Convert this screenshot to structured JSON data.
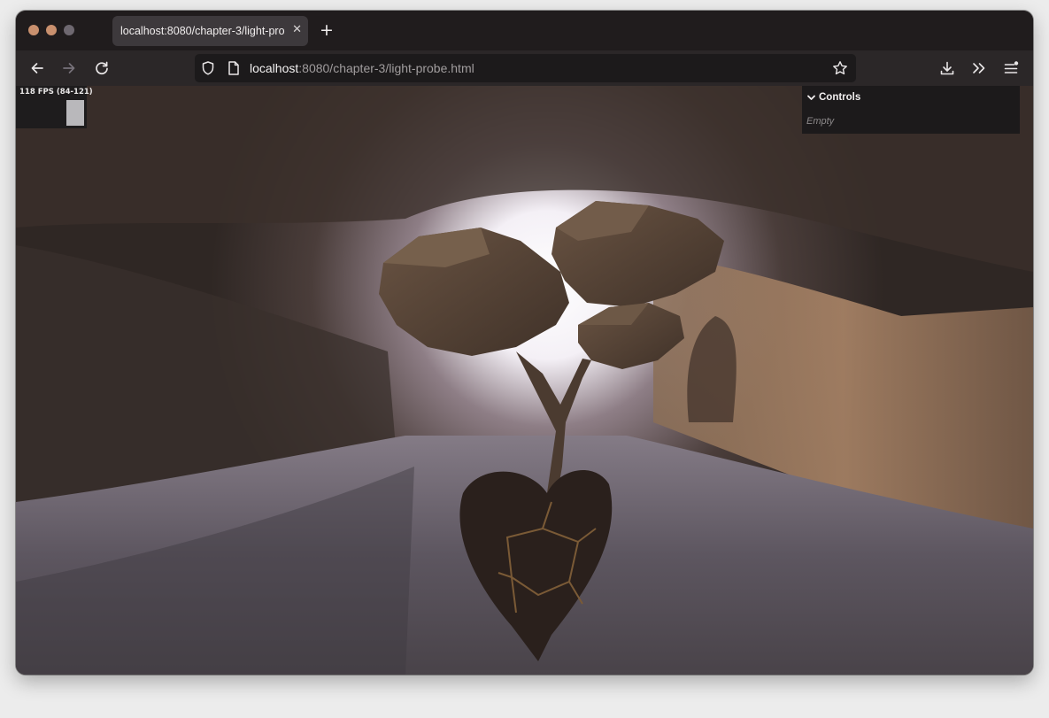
{
  "window": {
    "traffic_lights": [
      "close",
      "minimize",
      "maximize"
    ]
  },
  "tab": {
    "title": "localhost:8080/chapter-3/light-prob",
    "close_icon": "close-icon",
    "new_tab_icon": "plus-icon",
    "close_glyph": "✕",
    "new_tab_glyph": "+"
  },
  "toolbar": {
    "icons": [
      "back-arrow-icon",
      "forward-arrow-icon",
      "reload-icon",
      "shield-icon",
      "page-icon",
      "bookmark-star-icon",
      "download-icon",
      "overflow-chevrons-icon",
      "menu-icon"
    ]
  },
  "address": {
    "host": "localhost",
    "path": ":8080/chapter-3/light-probe.html"
  },
  "stats": {
    "label": "118 FPS (84-121)"
  },
  "controls": {
    "title": "Controls",
    "empty_label": "Empty",
    "chevron_icon": "chevron-down-icon"
  },
  "scene": {
    "description_icon": "3d-tree-model",
    "accent_colors": {
      "window_bg": "#201c1d",
      "tab_active": "#3d393c",
      "urlbar_bg": "#1c1a1b",
      "traffic_red": "#c9906e",
      "traffic_gray": "#6e6870"
    }
  }
}
